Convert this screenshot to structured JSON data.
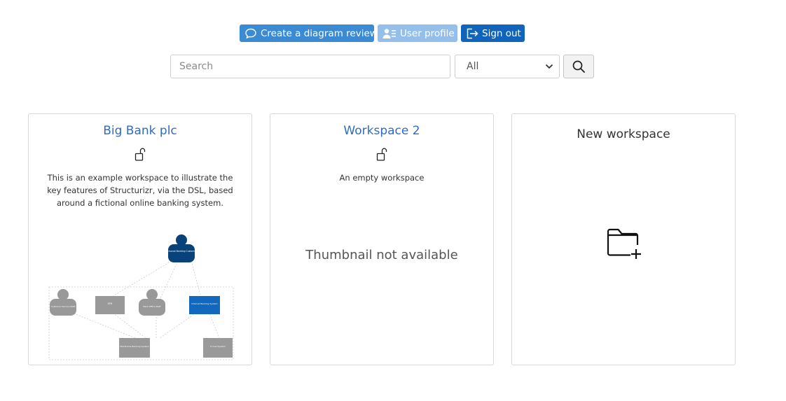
{
  "toolbar": {
    "review_label": "Create a diagram review",
    "profile_label": "User profile",
    "signout_label": "Sign out"
  },
  "search": {
    "placeholder": "Search",
    "filter_value": "All"
  },
  "colors": {
    "review": "#3b8bd4",
    "profile": "#93bfea",
    "signout": "#1164bb",
    "link": "#2e6cbf"
  },
  "workspaces": [
    {
      "name": "Big Bank plc",
      "description": "This is an example workspace to illustrate the key features of Structurizr, via the DSL, based around a fictional online banking system.",
      "icon": "unlock-icon",
      "thumbnail": {
        "person": "Personal Banking Customer",
        "elements": [
          "Customer Service Staff",
          "ATM",
          "Back Office Staff",
          "Internet Banking System",
          "Mainframe Banking System",
          "E-mail System"
        ]
      }
    },
    {
      "name": "Workspace 2",
      "description": "An empty workspace",
      "icon": "unlock-icon",
      "thumbnail_text": "Thumbnail not available"
    },
    {
      "name": "New workspace",
      "icon": "folder-plus-icon"
    }
  ]
}
